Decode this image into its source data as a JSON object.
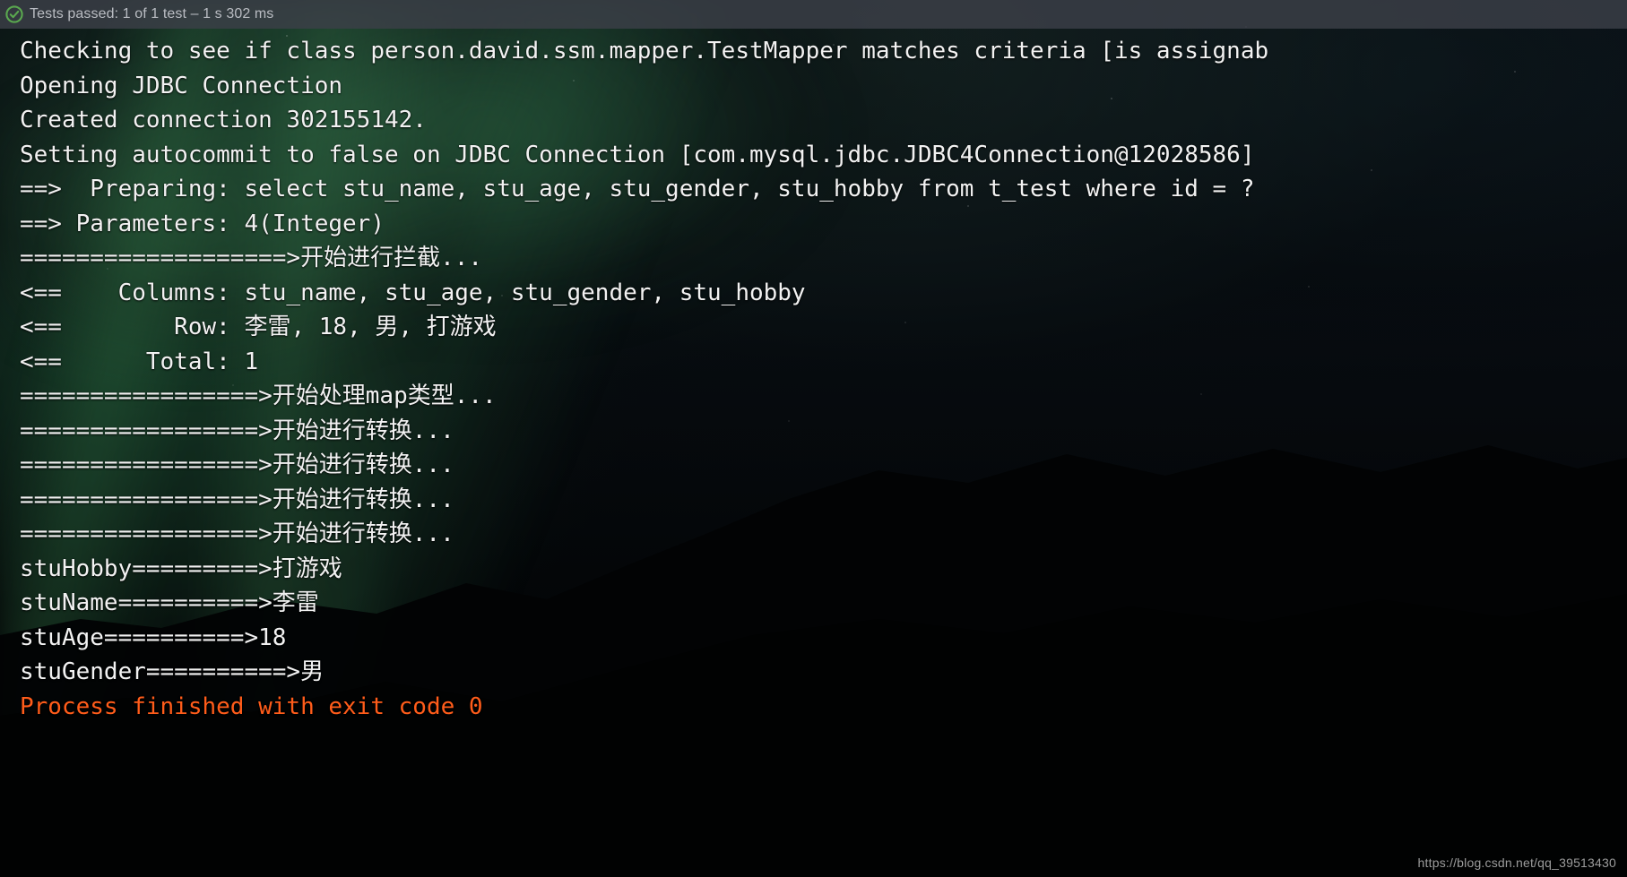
{
  "status_bar": {
    "icon": "check-circle-icon",
    "icon_color": "#4caf50",
    "text": "Tests passed: 1 of 1 test – 1 s 302 ms",
    "prefix": "Tests passed:",
    "detail": "1 of 1 test – 1 s 302 ms"
  },
  "console": {
    "background_color": "#05070a",
    "text_color": "#f2f2f2",
    "exit_color": "#ff5c1a",
    "lines": [
      {
        "text": "Checking to see if class person.david.ssm.mapper.TestMapper matches criteria [is assignab",
        "type": "log"
      },
      {
        "text": "Opening JDBC Connection",
        "type": "log"
      },
      {
        "text": "Created connection 302155142.",
        "type": "log"
      },
      {
        "text": "Setting autocommit to false on JDBC Connection [com.mysql.jdbc.JDBC4Connection@12028586]",
        "type": "log"
      },
      {
        "text": "==>  Preparing: select stu_name, stu_age, stu_gender, stu_hobby from t_test where id = ?",
        "type": "log"
      },
      {
        "text": "==> Parameters: 4(Integer)",
        "type": "log"
      },
      {
        "text": "===================>开始进行拦截...",
        "type": "log"
      },
      {
        "text": "<==    Columns: stu_name, stu_age, stu_gender, stu_hobby",
        "type": "log"
      },
      {
        "text": "<==        Row: 李雷, 18, 男, 打游戏",
        "type": "log"
      },
      {
        "text": "<==      Total: 1",
        "type": "log"
      },
      {
        "text": "=================>开始处理map类型...",
        "type": "log"
      },
      {
        "text": "=================>开始进行转换...",
        "type": "log"
      },
      {
        "text": "=================>开始进行转换...",
        "type": "log"
      },
      {
        "text": "=================>开始进行转换...",
        "type": "log"
      },
      {
        "text": "=================>开始进行转换...",
        "type": "log"
      },
      {
        "text": "stuHobby=========>打游戏",
        "type": "log"
      },
      {
        "text": "stuName==========>李雷",
        "type": "log"
      },
      {
        "text": "stuAge==========>18",
        "type": "log"
      },
      {
        "text": "stuGender==========>男",
        "type": "log"
      },
      {
        "text": "",
        "type": "blank"
      },
      {
        "text": "",
        "type": "blank"
      },
      {
        "text": "Process finished with exit code 0",
        "type": "exit"
      }
    ]
  },
  "watermark": {
    "text": "https://blog.csdn.net/qq_39513430"
  }
}
